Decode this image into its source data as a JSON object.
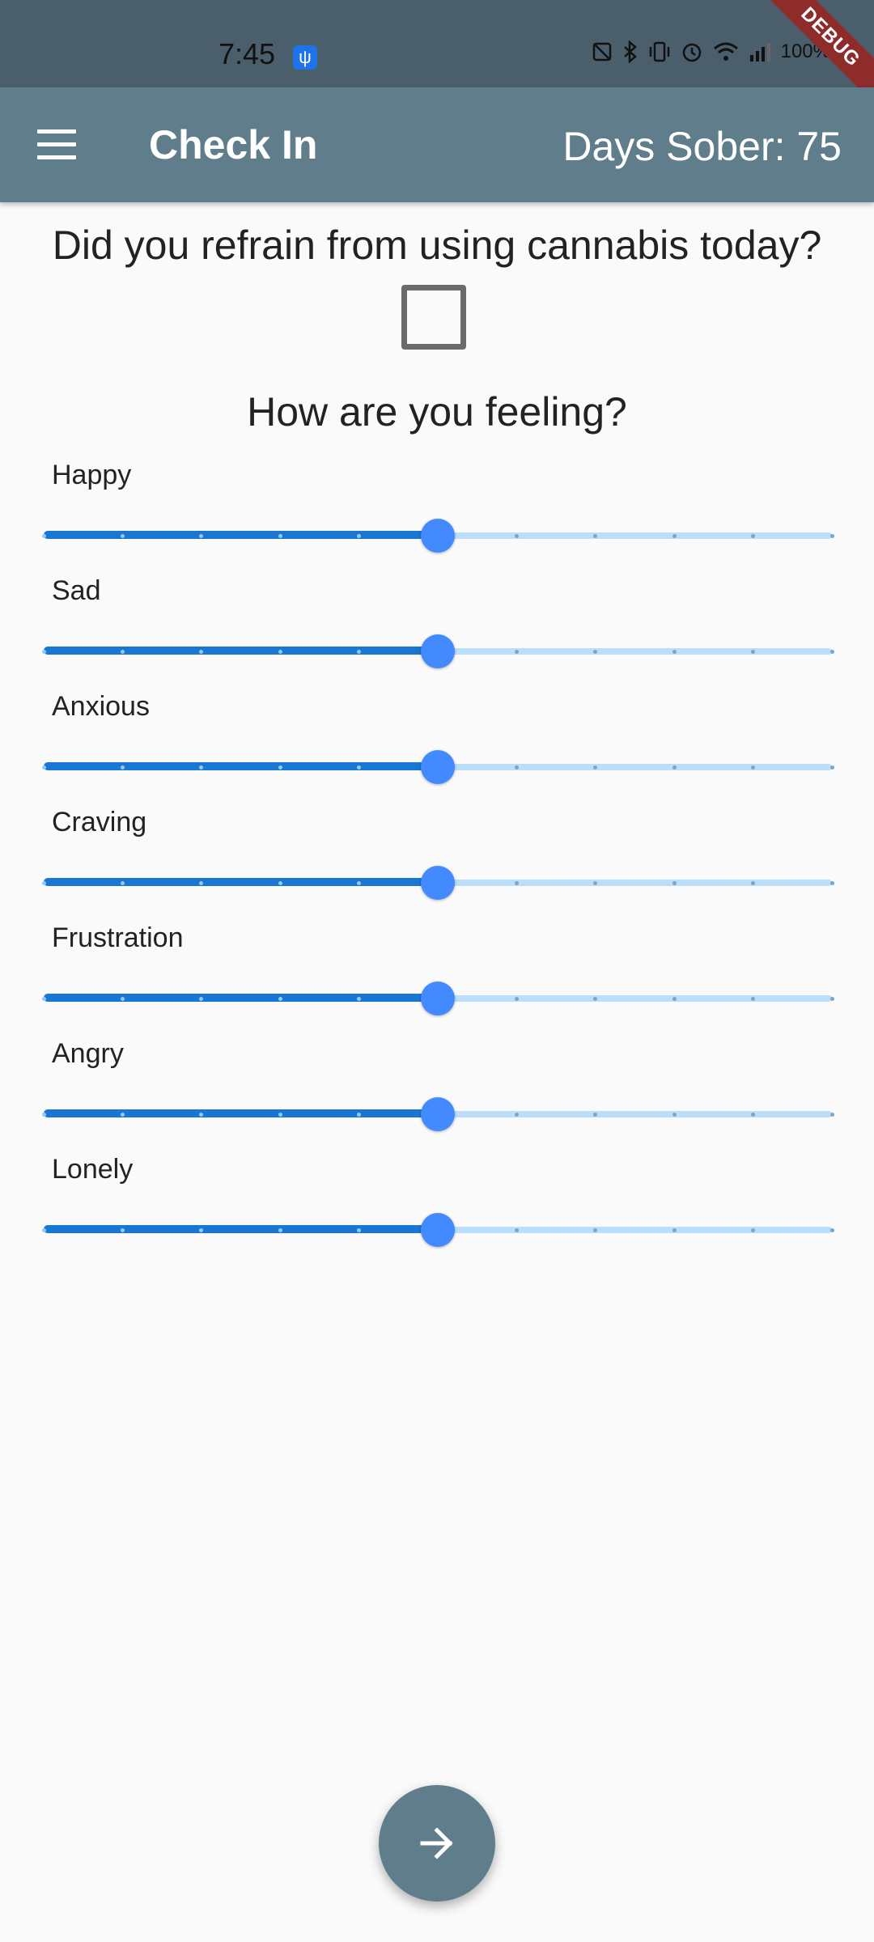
{
  "status_bar": {
    "time": "7:45",
    "battery": "100%"
  },
  "debug_ribbon": "DEBUG",
  "app_bar": {
    "title": "Check In",
    "days_sober": "Days Sober: 75"
  },
  "question": "Did you refrain from using cannabis today?",
  "checkbox_checked": false,
  "feeling_title": "How are you feeling?",
  "sliders": [
    {
      "label": "Happy",
      "value": 5,
      "min": 0,
      "max": 10
    },
    {
      "label": "Sad",
      "value": 5,
      "min": 0,
      "max": 10
    },
    {
      "label": "Anxious",
      "value": 5,
      "min": 0,
      "max": 10
    },
    {
      "label": "Craving",
      "value": 5,
      "min": 0,
      "max": 10
    },
    {
      "label": "Frustration",
      "value": 5,
      "min": 0,
      "max": 10
    },
    {
      "label": "Angry",
      "value": 5,
      "min": 0,
      "max": 10
    },
    {
      "label": "Lonely",
      "value": 5,
      "min": 0,
      "max": 10
    }
  ],
  "colors": {
    "app_bar": "#607d8b",
    "status_bar": "#4a5f6b",
    "slider_active": "#1976d2",
    "slider_inactive": "#bbdefb",
    "slider_thumb": "#448aff",
    "fab": "#607d8b"
  },
  "icons": {
    "menu": "menu-icon",
    "next": "arrow-right-icon"
  }
}
